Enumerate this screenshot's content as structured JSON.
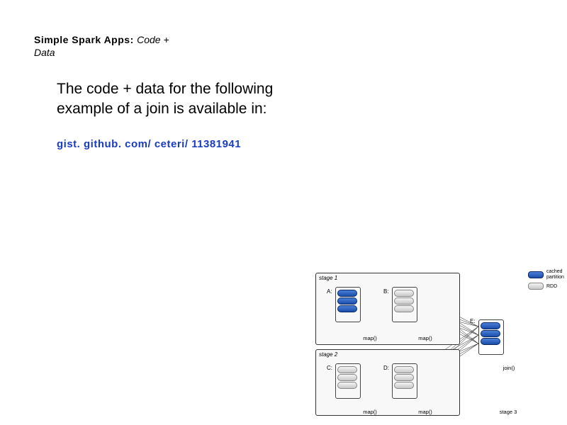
{
  "title": {
    "bold": "Simple Spark Apps: ",
    "ital_a": "Code + ",
    "ital_b": "Data"
  },
  "body": "The code + data for the following example of a join is available in:",
  "link": "gist. github. com/ ceteri/ 11381941",
  "diagram": {
    "stage1": "stage 1",
    "stage2": "stage 2",
    "stage3": "stage 3",
    "A": "A:",
    "B": "B:",
    "C": "C:",
    "D": "D:",
    "E": "E:",
    "map": "map()",
    "join": "join()"
  },
  "legend": {
    "cached": "cached\npartition",
    "rdd": "RDD"
  }
}
